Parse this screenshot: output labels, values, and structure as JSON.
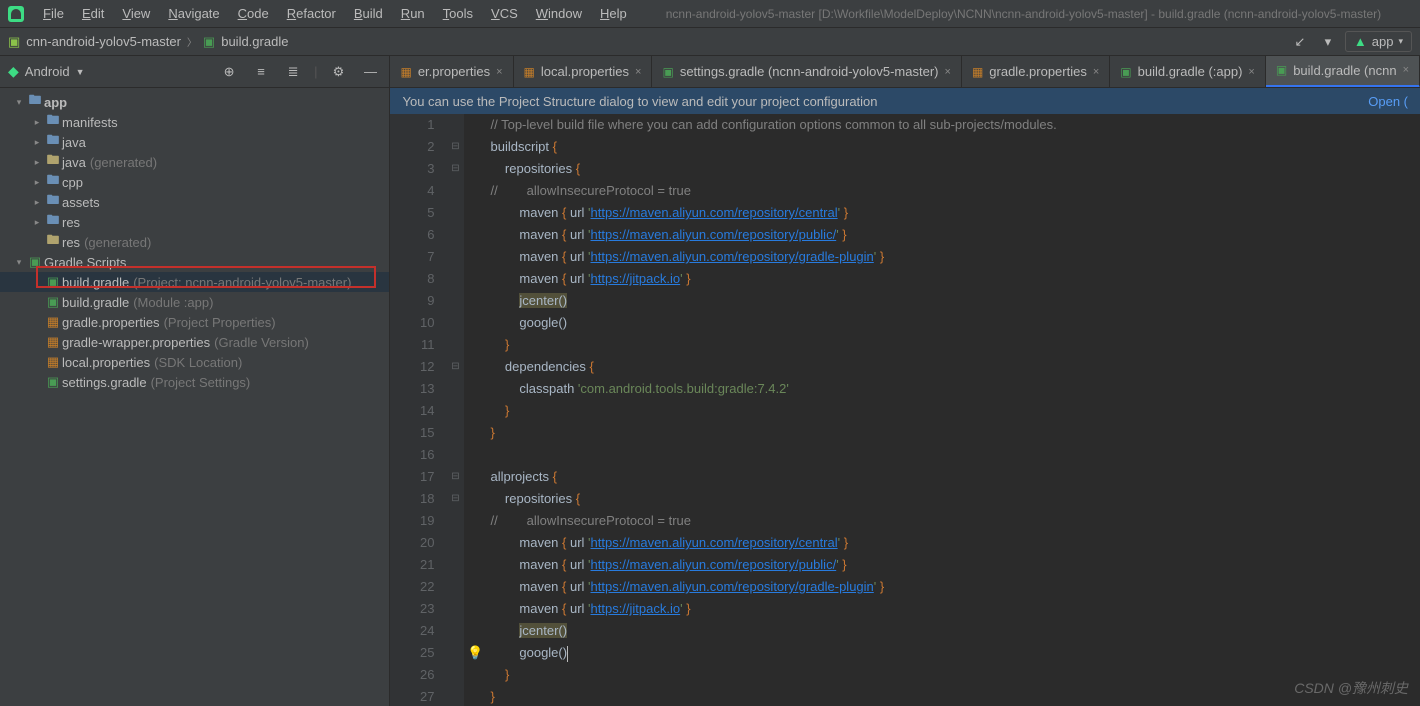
{
  "menu": [
    "File",
    "Edit",
    "View",
    "Navigate",
    "Code",
    "Refactor",
    "Build",
    "Run",
    "Tools",
    "VCS",
    "Window",
    "Help"
  ],
  "title_path": "ncnn-android-yolov5-master [D:\\Workfile\\ModelDeploy\\NCNN\\ncnn-android-yolov5-master] - build.gradle (ncnn-android-yolov5-master)",
  "breadcrumb": {
    "project": "cnn-android-yolov5-master",
    "file": "build.gradle"
  },
  "run_config": "app",
  "sidebar_title": "Android",
  "tree": [
    {
      "depth": 0,
      "arrow": "down",
      "icon": "folder-blue",
      "label": "app",
      "bold": true
    },
    {
      "depth": 1,
      "arrow": "right",
      "icon": "folder-blue",
      "label": "manifests"
    },
    {
      "depth": 1,
      "arrow": "right",
      "icon": "folder-blue",
      "label": "java"
    },
    {
      "depth": 1,
      "arrow": "right",
      "icon": "folder",
      "label": "java",
      "hint": "(generated)"
    },
    {
      "depth": 1,
      "arrow": "right",
      "icon": "folder-blue",
      "label": "cpp"
    },
    {
      "depth": 1,
      "arrow": "right",
      "icon": "folder-blue",
      "label": "assets"
    },
    {
      "depth": 1,
      "arrow": "right",
      "icon": "folder-blue",
      "label": "res"
    },
    {
      "depth": 1,
      "arrow": "",
      "icon": "folder",
      "label": "res",
      "hint": "(generated)"
    },
    {
      "depth": 0,
      "arrow": "down",
      "icon": "gradle",
      "label": "Gradle Scripts"
    },
    {
      "depth": 1,
      "arrow": "",
      "icon": "gradle",
      "label": "build.gradle",
      "hint": "(Project: ncnn-android-yolov5-master)",
      "selected": true
    },
    {
      "depth": 1,
      "arrow": "",
      "icon": "gradle",
      "label": "build.gradle",
      "hint": "(Module :app)"
    },
    {
      "depth": 1,
      "arrow": "",
      "icon": "prop",
      "label": "gradle.properties",
      "hint": "(Project Properties)"
    },
    {
      "depth": 1,
      "arrow": "",
      "icon": "prop",
      "label": "gradle-wrapper.properties",
      "hint": "(Gradle Version)"
    },
    {
      "depth": 1,
      "arrow": "",
      "icon": "prop",
      "label": "local.properties",
      "hint": "(SDK Location)"
    },
    {
      "depth": 1,
      "arrow": "",
      "icon": "gradle",
      "label": "settings.gradle",
      "hint": "(Project Settings)"
    }
  ],
  "tabs": [
    {
      "icon": "prop",
      "label": "er.properties",
      "active": false
    },
    {
      "icon": "prop",
      "label": "local.properties",
      "active": false
    },
    {
      "icon": "gradle",
      "label": "settings.gradle (ncnn-android-yolov5-master)",
      "active": false
    },
    {
      "icon": "prop",
      "label": "gradle.properties",
      "active": false
    },
    {
      "icon": "gradle",
      "label": "build.gradle (:app)",
      "active": false
    },
    {
      "icon": "gradle",
      "label": "build.gradle (ncnn",
      "active": true
    }
  ],
  "hint_text": "You can use the Project Structure dialog to view and edit your project configuration",
  "hint_link": "Open (",
  "code_lines": [
    {
      "n": 1,
      "fold": "",
      "bulb": "",
      "html": "<span class='cm'>// Top-level build file where you can add configuration options common to all sub-projects/modules.</span>"
    },
    {
      "n": 2,
      "fold": "⊟",
      "bulb": "",
      "html": "buildscript <span class='kw'>{</span>"
    },
    {
      "n": 3,
      "fold": "⊟",
      "bulb": "",
      "html": "    repositories <span class='kw'>{</span>"
    },
    {
      "n": 4,
      "fold": "",
      "bulb": "",
      "html": "<span class='cm'>//        allowInsecureProtocol = true</span>"
    },
    {
      "n": 5,
      "fold": "",
      "bulb": "",
      "html": "        maven <span class='kw'>{</span> url <span class='str'>'<span class='url'>https://maven.aliyun.com/repository/central</span>'</span> <span class='kw'>}</span>"
    },
    {
      "n": 6,
      "fold": "",
      "bulb": "",
      "html": "        maven <span class='kw'>{</span> url <span class='str'>'<span class='url'>https://maven.aliyun.com/repository/public/</span>'</span> <span class='kw'>}</span>"
    },
    {
      "n": 7,
      "fold": "",
      "bulb": "",
      "html": "        maven <span class='kw'>{</span> url <span class='str'>'<span class='url'>https://maven.aliyun.com/repository/gradle-plugin</span>'</span> <span class='kw'>}</span>"
    },
    {
      "n": 8,
      "fold": "",
      "bulb": "",
      "html": "        maven <span class='kw'>{</span> url <span class='str'>'<span class='url'>https://jitpack.io</span>'</span> <span class='kw'>}</span>"
    },
    {
      "n": 9,
      "fold": "",
      "bulb": "",
      "html": "        <span class='dep'>jcenter()</span>"
    },
    {
      "n": 10,
      "fold": "",
      "bulb": "",
      "html": "        google()"
    },
    {
      "n": 11,
      "fold": "",
      "bulb": "",
      "html": "    <span class='kw'>}</span>"
    },
    {
      "n": 12,
      "fold": "⊟",
      "bulb": "",
      "html": "    dependencies <span class='kw'>{</span>"
    },
    {
      "n": 13,
      "fold": "",
      "bulb": "",
      "html": "        classpath <span class='str'>'com.android.tools.build:gradle:7.4.2'</span>"
    },
    {
      "n": 14,
      "fold": "",
      "bulb": "",
      "html": "    <span class='kw'>}</span>"
    },
    {
      "n": 15,
      "fold": "",
      "bulb": "",
      "html": "<span class='kw'>}</span>"
    },
    {
      "n": 16,
      "fold": "",
      "bulb": "",
      "html": ""
    },
    {
      "n": 17,
      "fold": "⊟",
      "bulb": "",
      "html": "allprojects <span class='kw'>{</span>"
    },
    {
      "n": 18,
      "fold": "⊟",
      "bulb": "",
      "html": "    repositories <span class='kw'>{</span>"
    },
    {
      "n": 19,
      "fold": "",
      "bulb": "",
      "html": "<span class='cm'>//        allowInsecureProtocol = true</span>"
    },
    {
      "n": 20,
      "fold": "",
      "bulb": "",
      "html": "        maven <span class='kw'>{</span> url <span class='str'>'<span class='url'>https://maven.aliyun.com/repository/central</span>'</span> <span class='kw'>}</span>"
    },
    {
      "n": 21,
      "fold": "",
      "bulb": "",
      "html": "        maven <span class='kw'>{</span> url <span class='str'>'<span class='url'>https://maven.aliyun.com/repository/public/</span>'</span> <span class='kw'>}</span>"
    },
    {
      "n": 22,
      "fold": "",
      "bulb": "",
      "html": "        maven <span class='kw'>{</span> url <span class='str'>'<span class='url'>https://maven.aliyun.com/repository/gradle-plugin</span>'</span> <span class='kw'>}</span>"
    },
    {
      "n": 23,
      "fold": "",
      "bulb": "",
      "html": "        maven <span class='kw'>{</span> url <span class='str'>'<span class='url'>https://jitpack.io</span>'</span> <span class='kw'>}</span>"
    },
    {
      "n": 24,
      "fold": "",
      "bulb": "",
      "html": "        <span class='dep'>jcenter()</span>"
    },
    {
      "n": 25,
      "fold": "",
      "bulb": "bulb",
      "html": "        google()<span class='caret'></span>"
    },
    {
      "n": 26,
      "fold": "",
      "bulb": "",
      "html": "    <span class='kw'>}</span>"
    },
    {
      "n": 27,
      "fold": "",
      "bulb": "",
      "html": "<span class='kw'>}</span>"
    }
  ],
  "watermark": "CSDN @豫州刺史"
}
